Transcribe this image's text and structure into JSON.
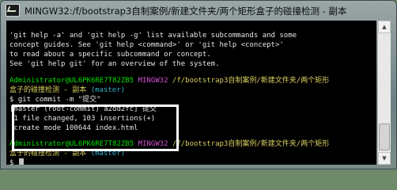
{
  "window": {
    "title": "MINGW32:/f/bootstrap3自制案例/新建文件夹/两个矩形盒子的碰撞检测 - 副本"
  },
  "terminal": {
    "help_lines": [
      "'git help -a' and 'git help -g' list available subcommands and some",
      "concept guides. See 'git help <command>' or 'git help <concept>'",
      "to read about a specific subcommand or concept.",
      "See 'git help git' for an overview of the system."
    ],
    "prompt1": {
      "user": "Administrator@UL6PK6RE7T82ZB5",
      "env": "MINGW32",
      "path_line1": "/f/bootstrap3自制案例/新建文件夹/两个矩形",
      "path_line2": "盒子的碰撞检测 - 副本",
      "branch": "(master)"
    },
    "command": "$ git commit -m \"提交\"",
    "output_lines": [
      "[master (root-commit) a2dd2fc] 提交",
      " 1 file changed, 103 insertions(+)",
      " create mode 100644 index.html"
    ],
    "prompt2": {
      "user": "Administrator@UL6PK6RE7T82ZB5",
      "env": "MINGW32",
      "path_line1": "/f/bootstrap3自制案例/新建文件夹/两个矩形",
      "path_line2": "盒子的碰撞检测 - 副本",
      "branch": "(master)"
    },
    "current_prompt": "$ "
  },
  "icons": {
    "app": "git-bash-icon",
    "scroll_up": "arrow-up-icon",
    "scroll_down": "arrow-down-icon"
  }
}
